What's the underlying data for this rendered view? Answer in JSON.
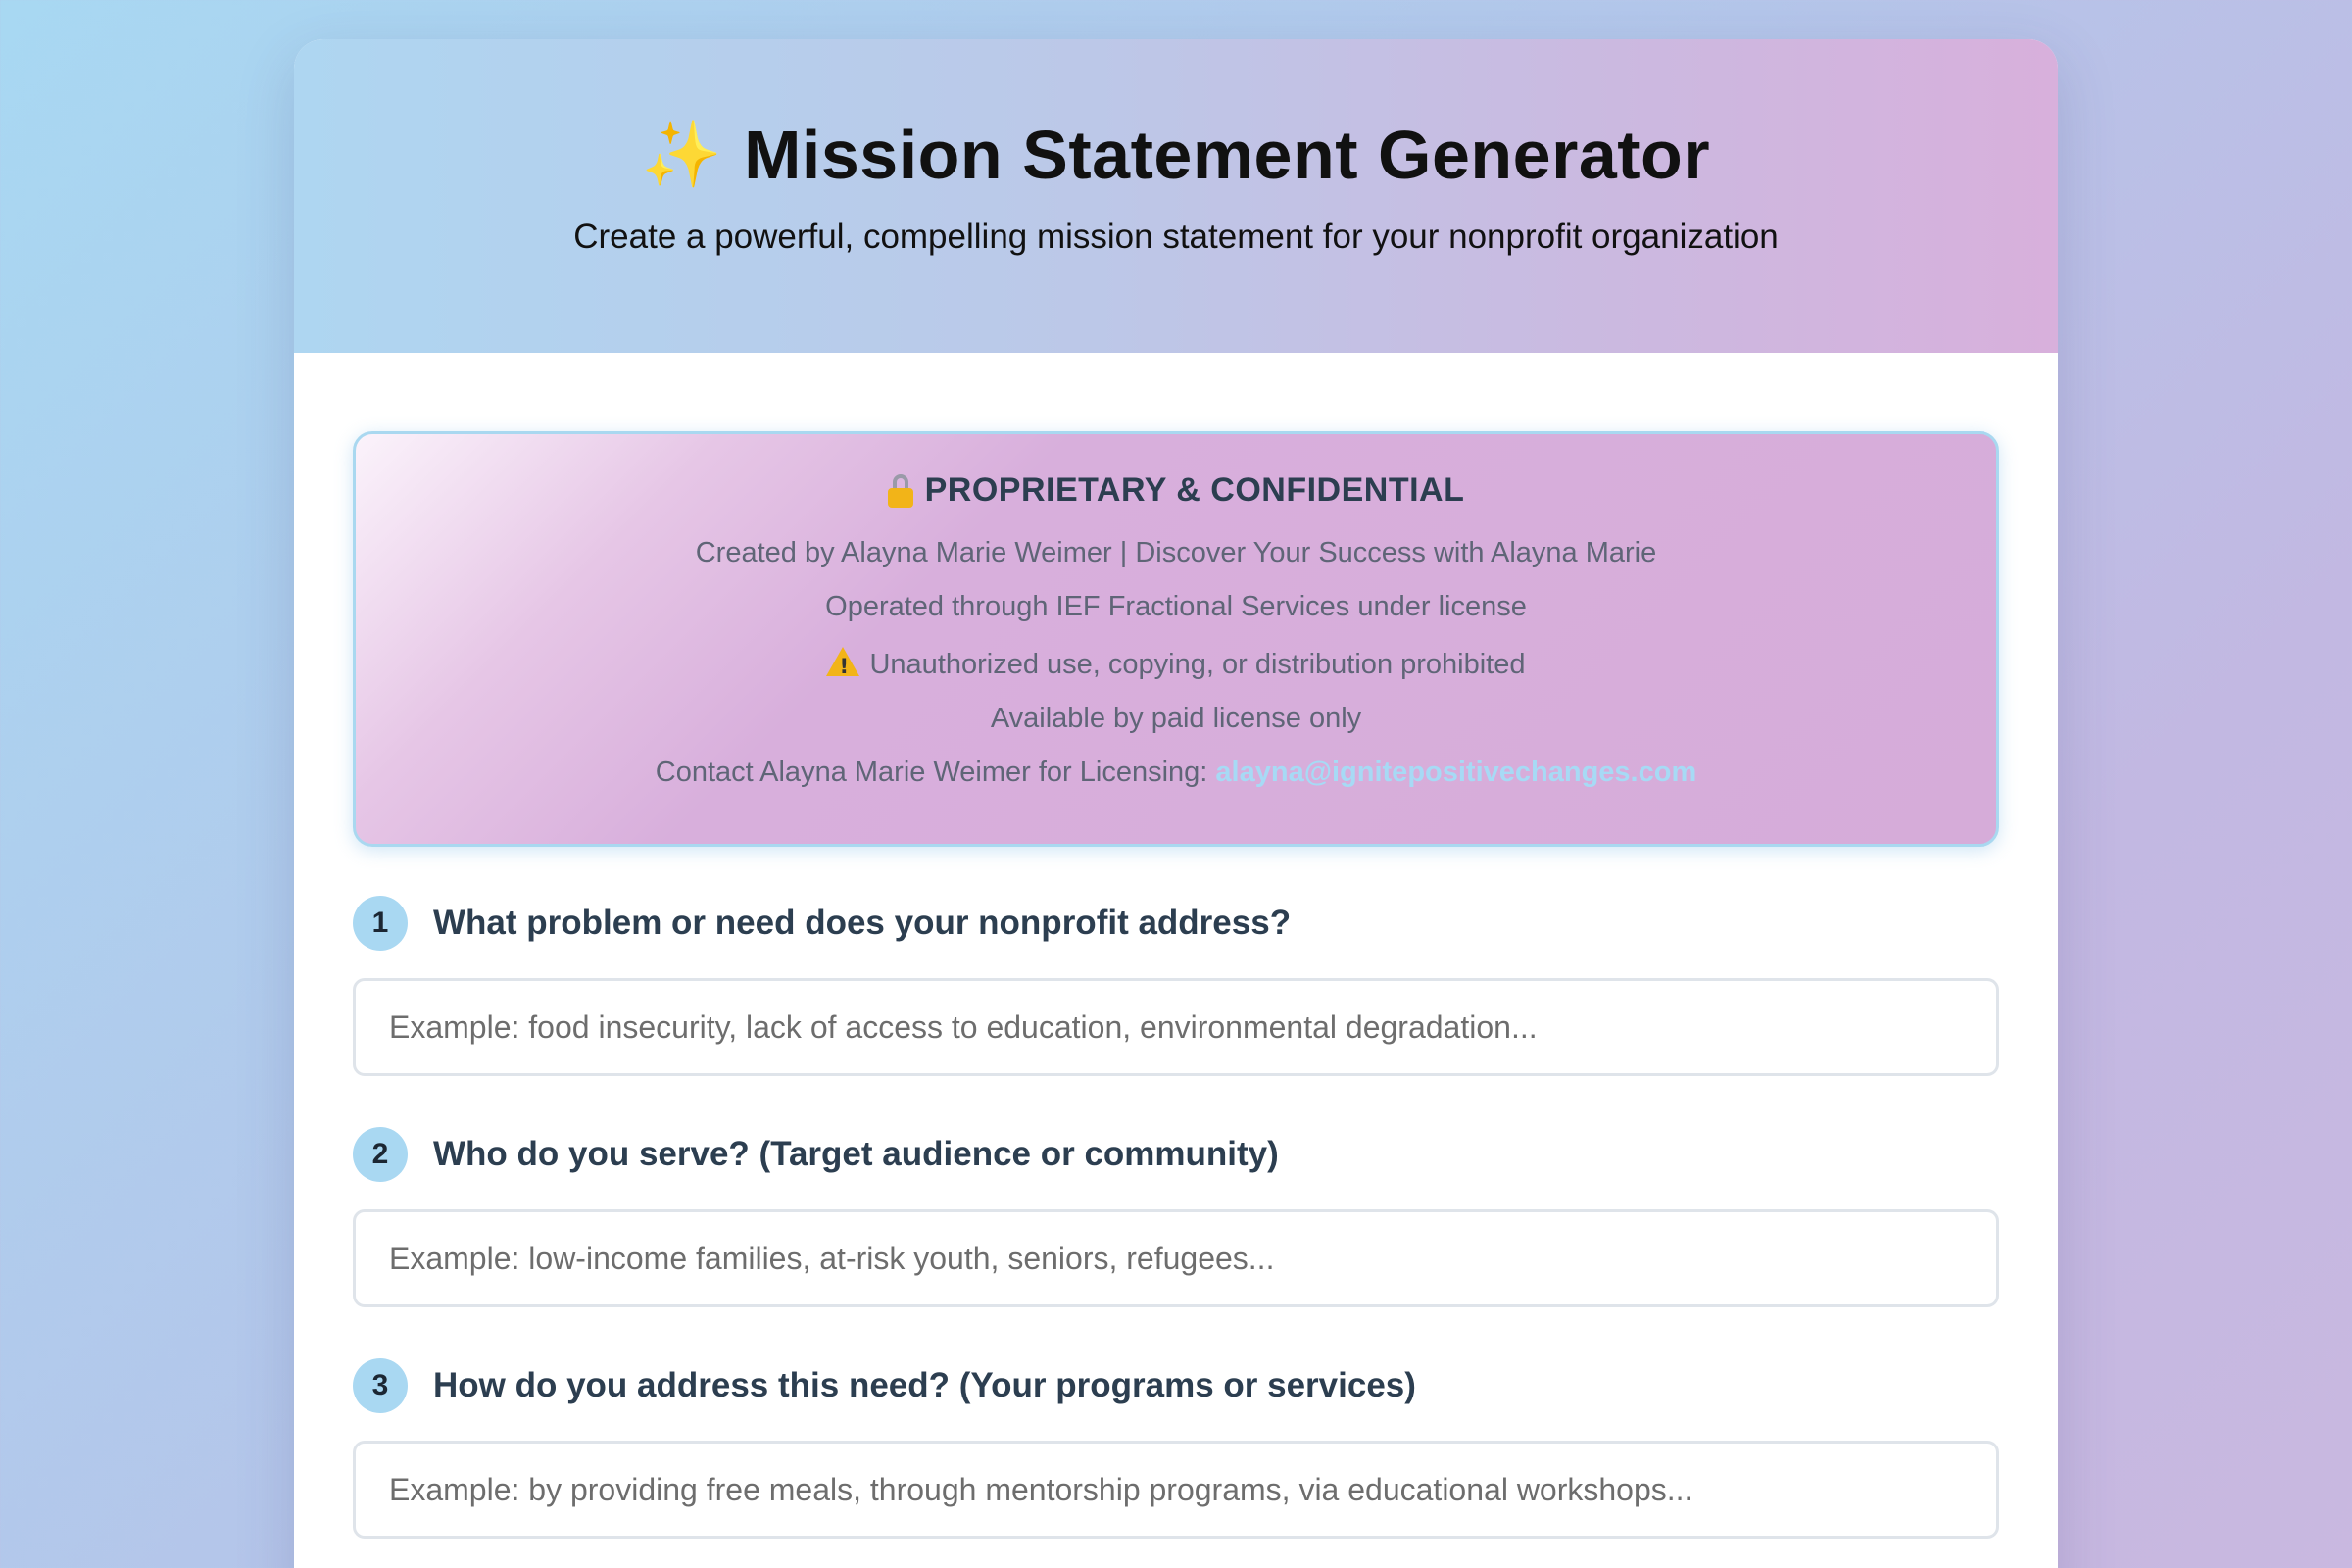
{
  "header": {
    "title": "Mission Statement Generator",
    "subtitle": "Create a powerful, compelling mission statement for your nonprofit organization",
    "title_icon": "sparkles-icon"
  },
  "notice": {
    "title": "PROPRIETARY & CONFIDENTIAL",
    "title_icon": "lock-icon",
    "lines": [
      "Created by Alayna Marie Weimer | Discover Your Success with Alayna Marie",
      "Operated through IEF Fractional Services under license",
      "Unauthorized use, copying, or distribution prohibited",
      "Available by paid license only"
    ],
    "warning_icon": "warning-icon",
    "contact_label": "Contact Alayna Marie Weimer for Licensing: ",
    "contact_email": "alayna@ignitepositivechanges.com"
  },
  "questions": [
    {
      "number": "1",
      "label": "What problem or need does your nonprofit address?",
      "value": "",
      "placeholder": "Example: food insecurity, lack of access to education, environmental degradation..."
    },
    {
      "number": "2",
      "label": "Who do you serve? (Target audience or community)",
      "value": "",
      "placeholder": "Example: low-income families, at-risk youth, seniors, refugees..."
    },
    {
      "number": "3",
      "label": "How do you address this need? (Your programs or services)",
      "value": "",
      "placeholder": "Example: by providing free meals, through mentorship programs, via educational workshops..."
    }
  ],
  "colors": {
    "accent_blue": "#a9d8f2",
    "notice_pink": "#d6acd9",
    "heading_dark": "#2c3e50",
    "link_blue": "#a7daf5"
  }
}
